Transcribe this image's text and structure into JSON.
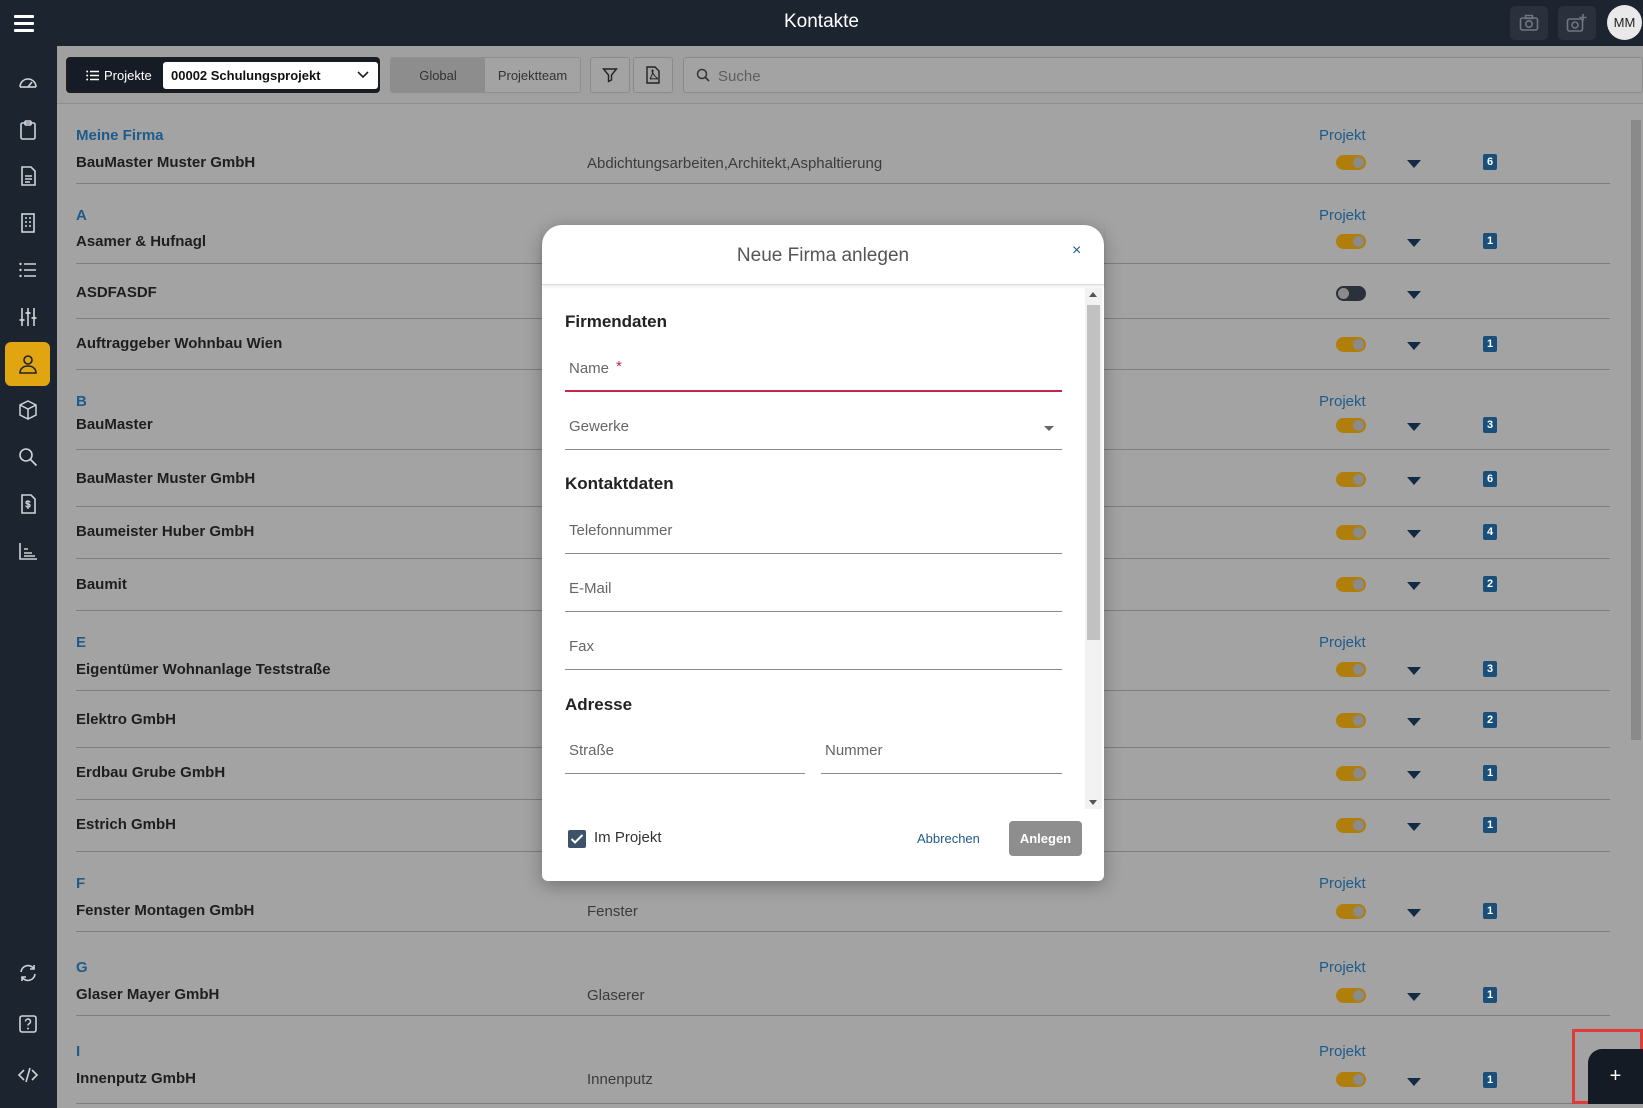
{
  "app": {
    "title": "Kontakte",
    "avatar_initials": "MM"
  },
  "toolbar": {
    "projects_label": "Projekte",
    "project_selected": "00002 Schulungsprojekt",
    "scope_global": "Global",
    "scope_team": "Projektteam",
    "search_placeholder": "Suche"
  },
  "list": {
    "project_header": "Projekt",
    "rows": [
      {
        "letter": "Meine Firma",
        "name": "BauMaster Muster GmbH",
        "trades": "Abdichtungsarbeiten,Architekt,Asphaltierung",
        "toggle": true,
        "count": "6"
      },
      {
        "letter": "A",
        "name": "Asamer & Hufnagl",
        "trades": "",
        "toggle": true,
        "count": "1"
      },
      {
        "letter": "",
        "name": "ASDFASDF",
        "trades": "",
        "toggle": false,
        "count": ""
      },
      {
        "letter": "",
        "name": "Auftraggeber Wohnbau Wien",
        "trades": "",
        "toggle": true,
        "count": "1"
      },
      {
        "letter": "B",
        "name": "BauMaster",
        "trades": "",
        "toggle": true,
        "count": "3"
      },
      {
        "letter": "",
        "name": "BauMaster Muster GmbH",
        "trades": "",
        "toggle": true,
        "count": "6"
      },
      {
        "letter": "",
        "name": "Baumeister Huber GmbH",
        "trades": "",
        "toggle": true,
        "count": "4"
      },
      {
        "letter": "",
        "name": "Baumit",
        "trades": "",
        "toggle": true,
        "count": "2"
      },
      {
        "letter": "E",
        "name": "Eigentümer Wohnanlage Teststraße",
        "trades": "",
        "toggle": true,
        "count": "3"
      },
      {
        "letter": "",
        "name": "Elektro GmbH",
        "trades": "",
        "toggle": true,
        "count": "2"
      },
      {
        "letter": "",
        "name": "Erdbau Grube GmbH",
        "trades": "",
        "toggle": true,
        "count": "1"
      },
      {
        "letter": "",
        "name": "Estrich GmbH",
        "trades": "",
        "toggle": true,
        "count": "1"
      },
      {
        "letter": "F",
        "name": "Fenster Montagen GmbH",
        "trades": "Fenster",
        "toggle": true,
        "count": "1"
      },
      {
        "letter": "G",
        "name": "Glaser Mayer GmbH",
        "trades": "Glaserer",
        "toggle": true,
        "count": "1"
      },
      {
        "letter": "I",
        "name": "Innenputz GmbH",
        "trades": "Innenputz",
        "toggle": true,
        "count": "1"
      }
    ]
  },
  "modal": {
    "title": "Neue Firma anlegen",
    "close": "×",
    "section_company": "Firmendaten",
    "name_placeholder": "Name",
    "required_mark": "*",
    "trades_placeholder": "Gewerke",
    "section_contact": "Kontaktdaten",
    "phone_placeholder": "Telefonnummer",
    "email_placeholder": "E-Mail",
    "fax_placeholder": "Fax",
    "section_address": "Adresse",
    "street_placeholder": "Straße",
    "number_placeholder": "Nummer",
    "in_project_label": "Im Projekt",
    "in_project_checked": true,
    "cancel_label": "Abbrechen",
    "create_label": "Anlegen"
  },
  "fab": {
    "label": "+"
  },
  "colors": {
    "accent": "#e1a512",
    "link": "#1f5b8a",
    "sidebar": "#1c2430",
    "error": "#c0284c"
  }
}
